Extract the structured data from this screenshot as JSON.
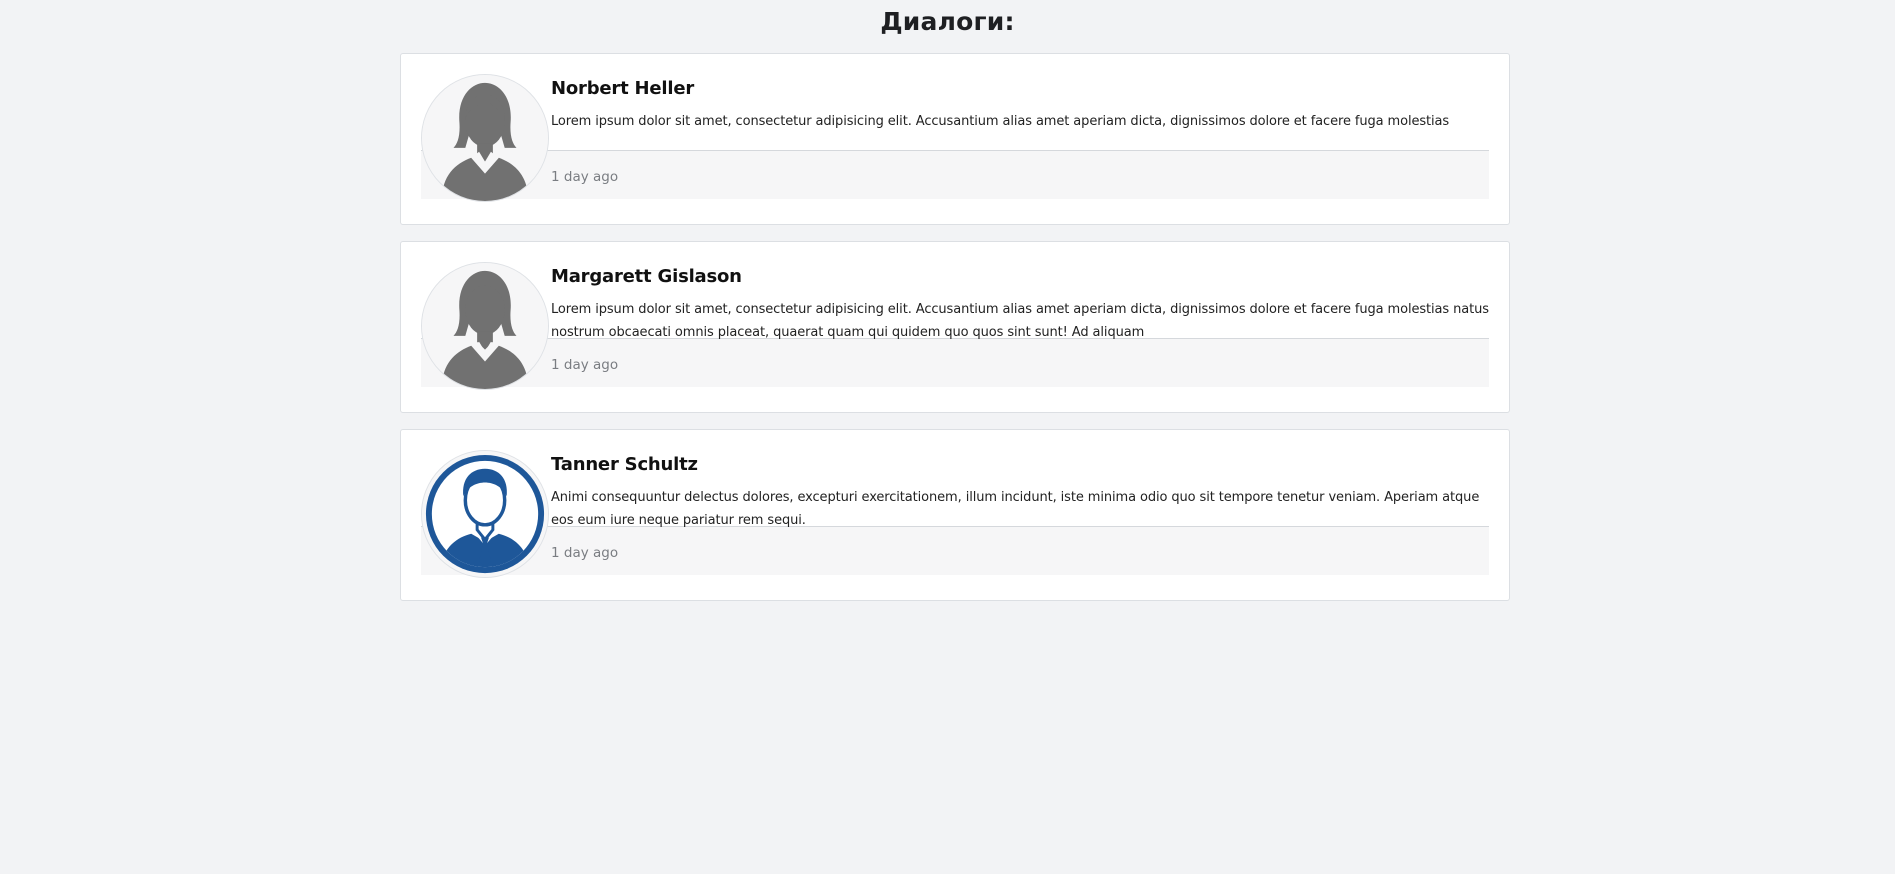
{
  "page": {
    "title": "Диалоги:"
  },
  "dialogs": [
    {
      "name": "Norbert Heller",
      "message": "Lorem ipsum dolor sit amet, consectetur adipisicing elit. Accusantium alias amet aperiam dicta, dignissimos dolore et facere fuga molestias",
      "time": "1 day ago",
      "avatar_icon": "female-user-icon"
    },
    {
      "name": "Margarett Gislason",
      "message": "Lorem ipsum dolor sit amet, consectetur adipisicing elit. Accusantium alias amet aperiam dicta, dignissimos dolore et facere fuga molestias natus nostrum obcaecati omnis placeat, quaerat quam qui quidem quo quos sint sunt! Ad aliquam",
      "time": "1 day ago",
      "avatar_icon": "female-user-icon"
    },
    {
      "name": "Tanner Schultz",
      "message": "Animi consequuntur delectus dolores, excepturi exercitationem, illum incidunt, iste minima odio quo sit tempore tenetur veniam. Aperiam atque eos eum iure neque pariatur rem sequi.",
      "time": "1 day ago",
      "avatar_icon": "male-user-icon"
    }
  ],
  "colors": {
    "background": "#f2f3f5",
    "card": "#ffffff",
    "female_avatar": "#717171",
    "male_avatar": "#1e5799",
    "muted_text": "#7a7d82"
  }
}
